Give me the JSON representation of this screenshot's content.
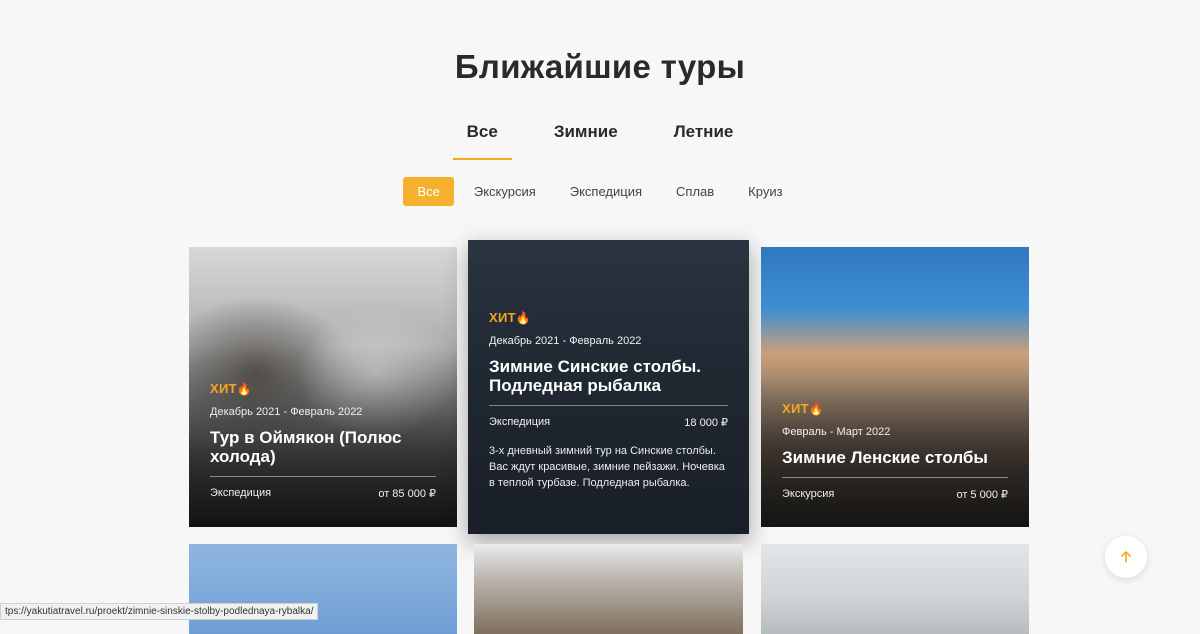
{
  "title": "Ближайшие туры",
  "season_tabs": [
    {
      "label": "Все",
      "active": true
    },
    {
      "label": "Зимние",
      "active": false
    },
    {
      "label": "Летние",
      "active": false
    }
  ],
  "type_filters": [
    {
      "label": "Все",
      "active": true
    },
    {
      "label": "Экскурсия",
      "active": false
    },
    {
      "label": "Экспедиция",
      "active": false
    },
    {
      "label": "Сплав",
      "active": false
    },
    {
      "label": "Круиз",
      "active": false
    }
  ],
  "cards": [
    {
      "badge": "ХИТ",
      "dates": "Декабрь 2021 - Февраль 2022",
      "title": "Тур в Оймякон (Полюс холода)",
      "type": "Экспедиция",
      "price": "от 85 000 ₽"
    },
    {
      "badge": "ХИТ",
      "dates": "Декабрь 2021 - Февраль 2022",
      "title": "Зимние Синские столбы. Подледная рыбалка",
      "type": "Экспедиция",
      "price": "18 000 ₽",
      "description": "3-х дневный зимний тур на Синские столбы. Вас ждут красивые, зимние пейзажи. Ночевка в теплой турбазе. Подледная рыбалка."
    },
    {
      "badge": "ХИТ",
      "dates": "Февраль - Март 2022",
      "title": "Зимние Ленские столбы",
      "type": "Экскурсия",
      "price": "от 5 000 ₽"
    }
  ],
  "status_url": "tps://yakutiatravel.ru/proekt/zimnie-sinskie-stolby-podlednaya-rybalka/",
  "colors": {
    "accent": "#f5a623",
    "filter_active": "#f5b02e"
  },
  "icons": {
    "flame": "flame-icon",
    "scroll_top": "arrow-up-icon"
  }
}
